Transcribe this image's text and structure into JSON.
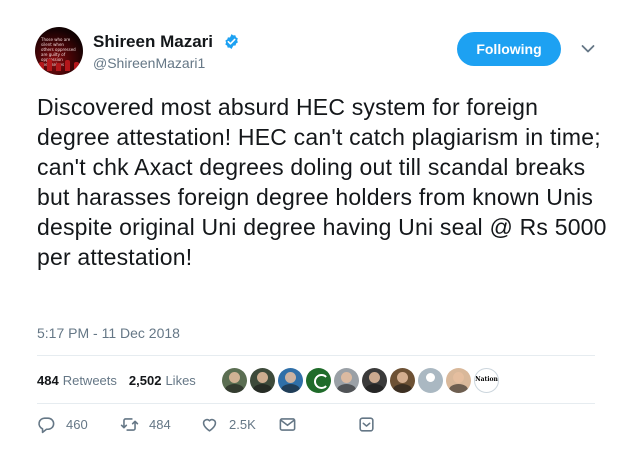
{
  "author": {
    "name": "Shireen Mazari",
    "handle": "@ShireenMazari1",
    "avatar_text": "Those who are silent when others oppressed are guilty of oppression themselves",
    "verified_icon": "verified-badge-icon"
  },
  "follow_button": {
    "label": "Following"
  },
  "menu_icon": "chevron-down-icon",
  "tweet": {
    "text": "Discovered most absurd HEC system for foreign degree attestation! HEC can't catch plagiarism in time; can't chk Axact degrees doling out till scandal breaks but harasses foreign degree holders from known Unis despite original Uni degree having Uni seal @ Rs 5000 per attestation!",
    "timestamp": "5:17 PM - 11 Dec 2018"
  },
  "stats": {
    "retweets_count": "484",
    "retweets_label": "Retweets",
    "likes_count": "2,502",
    "likes_label": "Likes"
  },
  "likers": [
    {
      "name": "liker-1",
      "color": "#5b6e52"
    },
    {
      "name": "liker-2",
      "color": "#3d4a3a"
    },
    {
      "name": "liker-3",
      "color": "#2f6fa8"
    },
    {
      "name": "liker-4",
      "color": "#1f6b2a"
    },
    {
      "name": "liker-5",
      "color": "#9aa0a6"
    },
    {
      "name": "liker-6",
      "color": "#3a3a3a"
    },
    {
      "name": "liker-7",
      "color": "#6d5134"
    },
    {
      "name": "liker-8",
      "color": "#aab8c2"
    },
    {
      "name": "liker-9",
      "color": "#d9b89a"
    },
    {
      "name": "liker-10",
      "color": "#ffffff"
    }
  ],
  "liker_logo_text": "Nation",
  "actions": {
    "replies": "460",
    "retweets": "484",
    "likes": "2.5K"
  },
  "colors": {
    "accent": "#1da1f2",
    "text": "#14171a",
    "muted": "#657786",
    "divider": "#e6ecf0"
  }
}
